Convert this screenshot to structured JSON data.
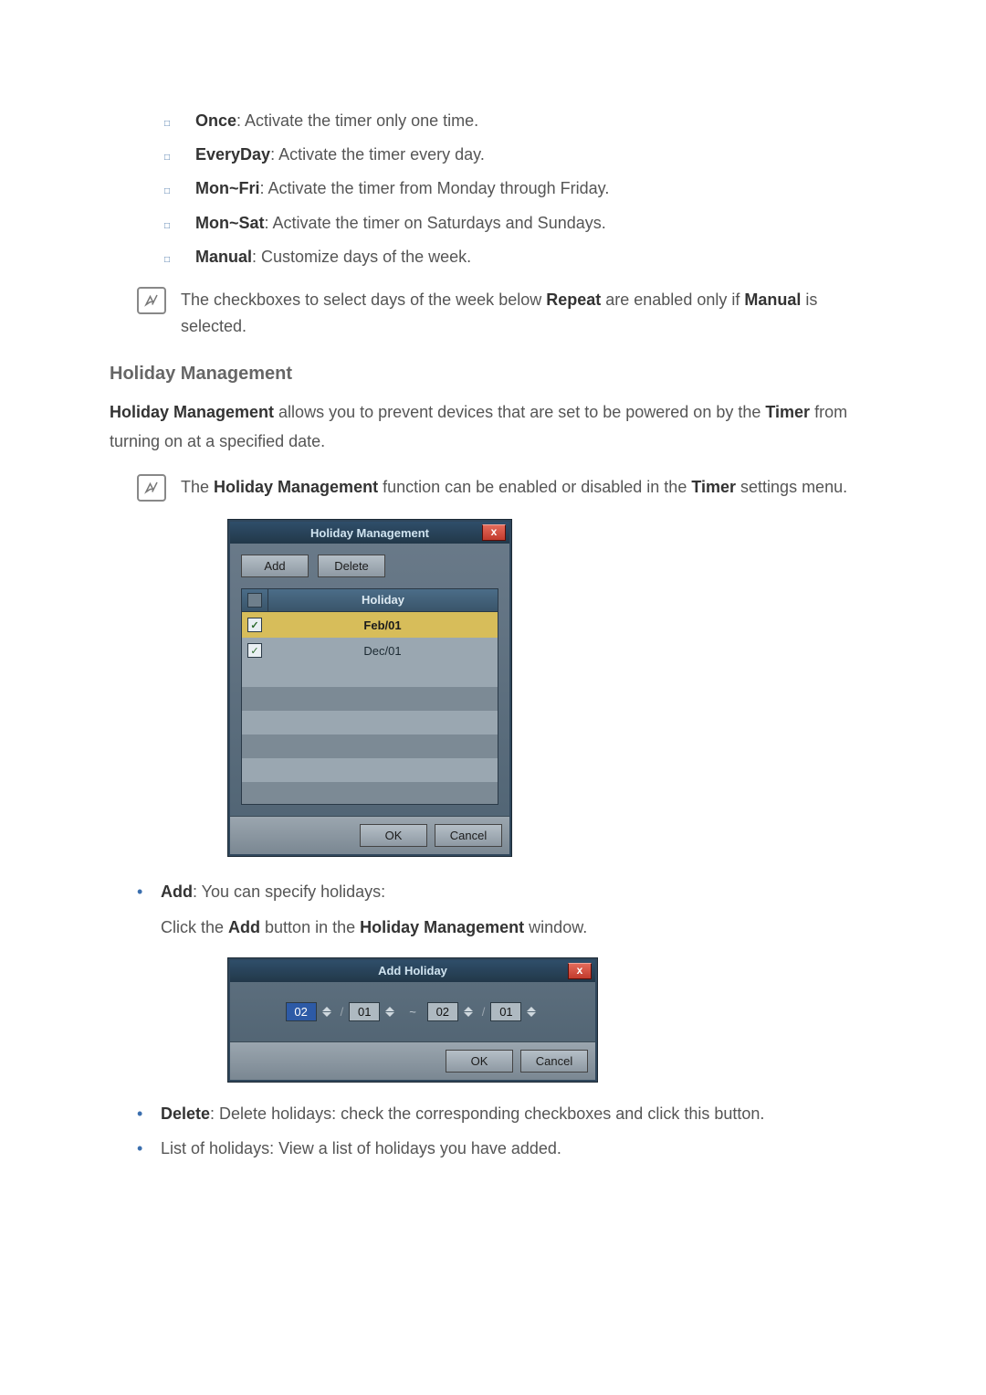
{
  "options": [
    {
      "label": "Once",
      "desc": "Activate the timer only one time."
    },
    {
      "label": "EveryDay",
      "desc": "Activate the timer every day."
    },
    {
      "label": "Mon~Fri",
      "desc": "Activate the timer from Monday through Friday."
    },
    {
      "label": "Mon~Sat",
      "desc": "Activate the timer on Saturdays and Sundays."
    },
    {
      "label": "Manual",
      "desc": "Customize days of the week."
    }
  ],
  "note1_pre": "The checkboxes to select days of the week below ",
  "note1_b1": "Repeat",
  "note1_mid": " are enabled only if ",
  "note1_b2": "Manual",
  "note1_post": " is selected.",
  "section_title": "Holiday Management",
  "hm_pre_b": "Holiday Management",
  "hm_mid": " allows you to prevent devices that are set to be powered on by the ",
  "hm_b2": "Timer",
  "hm_post": " from turning on at a specified date.",
  "note2_pre": "The ",
  "note2_b": "Holiday Management",
  "note2_mid": " function can be enabled or disabled in the ",
  "note2_b2": "Timer",
  "note2_post": " settings menu.",
  "dialog1": {
    "title": "Holiday Management",
    "close": "x",
    "add_btn": "Add",
    "delete_btn": "Delete",
    "col": "Holiday",
    "rows": [
      {
        "checked": true,
        "value": "Feb/01",
        "selected": true
      },
      {
        "checked": true,
        "value": "Dec/01",
        "selected": false
      }
    ],
    "ok": "OK",
    "cancel": "Cancel"
  },
  "add_item_b": "Add",
  "add_item_rest": ": You can specify holidays:",
  "add_line2_pre": "Click the ",
  "add_line2_b1": "Add",
  "add_line2_mid": " button in the ",
  "add_line2_b2": "Holiday Management",
  "add_line2_post": " window.",
  "dialog2": {
    "title": "Add Holiday",
    "close": "x",
    "mm1": "02",
    "dd1": "01",
    "mm2": "02",
    "dd2": "01",
    "ok": "OK",
    "cancel": "Cancel"
  },
  "delete_b": "Delete",
  "delete_rest": ": Delete holidays: check the corresponding checkboxes and click this button.",
  "list_text": "List of holidays: View a list of holidays you have added.",
  "checkmark": "✓"
}
